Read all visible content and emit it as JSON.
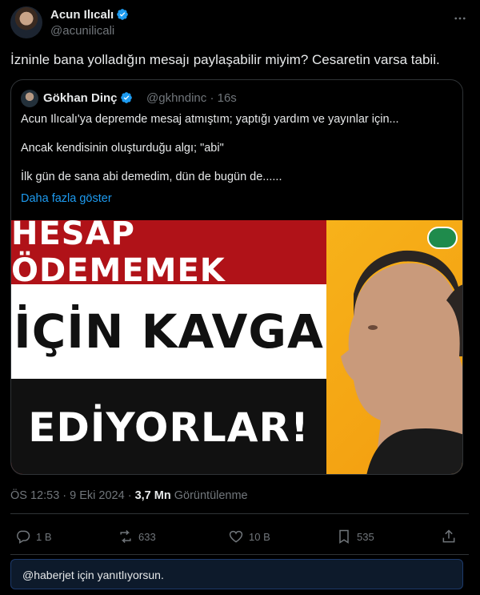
{
  "author": {
    "name": "Acun Ilıcalı",
    "handle": "@acunilicali"
  },
  "tweet": {
    "text": "İzninle bana yolladığın mesajı paylaşabilir miyim? Cesaretin varsa tabii."
  },
  "quote": {
    "name": "Gökhan Dinç",
    "handle": "@gkhndinc",
    "age": "16s",
    "lines": [
      "Acun Ilıcalı'ya depremde mesaj atmıştım; yaptığı yardım ve yayınlar için...",
      "Ancak kendisinin oluşturduğu algı; \"abi\"",
      "İlk gün de sana abi demedim, dün de bugün de......"
    ],
    "show_more": "Daha fazla göster",
    "media": {
      "line1": "HESAP ÖDEMEMEK",
      "line2": "İÇİN KAVGA",
      "line3": "EDİYORLAR!"
    }
  },
  "meta": {
    "time": "ÖS 12:53",
    "date": "9 Eki 2024",
    "views_count": "3,7 Mn",
    "views_label": "Görüntülenme"
  },
  "actions": {
    "reply_count": "1 B",
    "retweet_count": "633",
    "like_count": "10 B",
    "bookmark_count": "535"
  },
  "reply": {
    "text": "@haberjet için yanıtlıyorsun."
  },
  "colors": {
    "background": "#000000",
    "text": "#e7e9ea",
    "muted": "#71767b",
    "link": "#1d9bf0",
    "verified": "#1d9bf0"
  }
}
